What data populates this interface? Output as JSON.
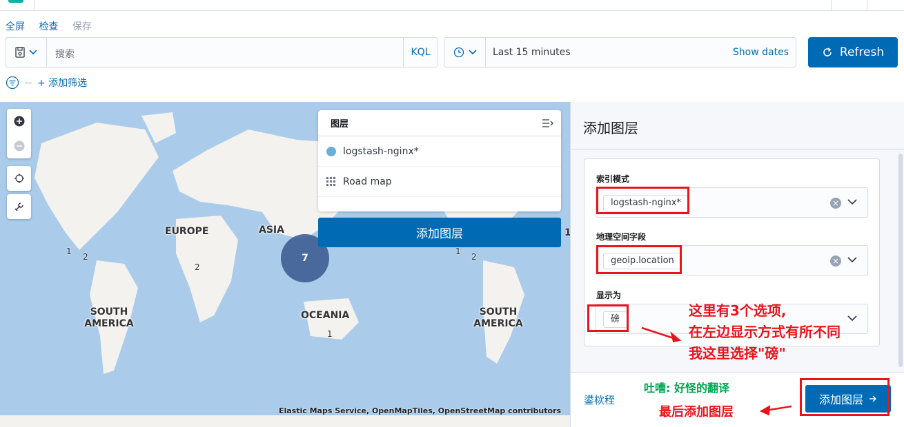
{
  "menu": {
    "fullscreen": "全屏",
    "inspect": "检查",
    "save": "保存"
  },
  "query": {
    "placeholder": "搜索",
    "language": "KQL"
  },
  "time": {
    "range": "Last 15 minutes",
    "show_dates": "Show dates"
  },
  "refresh_label": "Refresh",
  "filters": {
    "add_filter": "+ 添加筛选"
  },
  "map": {
    "regions": {
      "europe": "EUROPE",
      "asia": "ASIA",
      "south_america": "SOUTH AMERICA",
      "oceania": "OCEANIA"
    },
    "counts": [
      "1",
      "2",
      "2",
      "7",
      "1",
      "1",
      "2",
      "1"
    ],
    "attribution": "Elastic Maps Service, OpenMapTiles, OpenStreetMap contributors",
    "layers_panel": {
      "title": "图层",
      "items": [
        {
          "label": "logstash-nginx*",
          "icon": "circle-dot-icon"
        },
        {
          "label": "Road map",
          "icon": "grid-icon"
        }
      ]
    },
    "add_layer_button": "添加图层"
  },
  "panel": {
    "title": "添加图层",
    "fields": {
      "index_pattern": {
        "label": "索引模式",
        "value": "logstash-nginx*"
      },
      "geo_field": {
        "label": "地理空间字段",
        "value": "geoip.location"
      },
      "display_as": {
        "label": "显示为",
        "value": "磅"
      }
    },
    "cancel": "鍙栨秷",
    "add_layer": "添加图层"
  },
  "annotations": {
    "note_line1": "这里有3个选项,",
    "note_line2": "在左边显示方式有所不同",
    "note_line3": "我这里选择\"磅\"",
    "complaint": "吐嘈: 好怪的翻译",
    "final": "最后添加图层"
  },
  "colors": {
    "primary": "#006bb4",
    "annotation_red": "#e8141c",
    "annotation_green": "#00a651",
    "ocean": "#aacbea",
    "cluster": "#3f5f94"
  }
}
